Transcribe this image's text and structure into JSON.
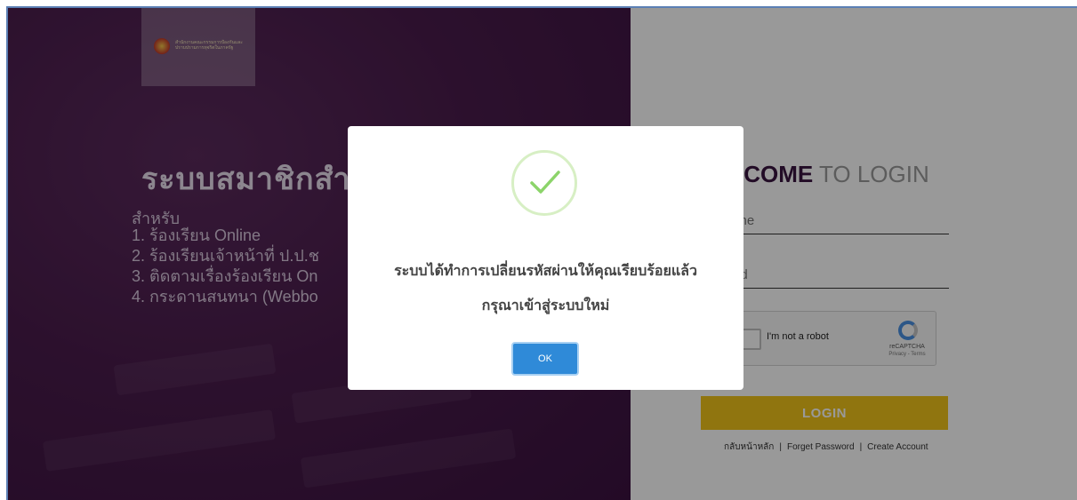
{
  "left": {
    "logo_text": "สำนักงานคณะกรรมการป้องกันและปราบปรามการทุจริตในภาครัฐ",
    "title": "ระบบสมาชิกสำ",
    "for_label": "สำหรับ",
    "features": [
      "1. ร้องเรียน Online",
      "2. ร้องเรียนเจ้าหน้าที่ ป.ป.ช",
      "3. ติดตามเรื่องร้องเรียน On",
      "4. กระดานสนทนา (Webbo"
    ]
  },
  "right": {
    "welcome_bold": ".COME",
    "welcome_rest": " TO LOGIN",
    "username_placeholder": "ame",
    "password_placeholder": "ord",
    "captcha_label": "I'm not a robot",
    "captcha_brand": "reCAPTCHA",
    "captcha_terms": "Privacy - Terms",
    "login_label": "LOGIN",
    "links": [
      "กลับหน้าหลัก",
      "Forget Password",
      "Create Account"
    ]
  },
  "modal": {
    "message_line1": "ระบบได้ทำการเปลี่ยนรหัสผ่านให้คุณเรียบร้อยแล้ว",
    "message_line2": "กรุณาเข้าสู่ระบบใหม่",
    "ok_label": "OK",
    "icon": "success-check-icon"
  },
  "colors": {
    "purple": "#4a1c4c",
    "accent_gold": "#f0c419",
    "ok_blue": "#2f8ad8",
    "success_green": "#8cd46a"
  }
}
